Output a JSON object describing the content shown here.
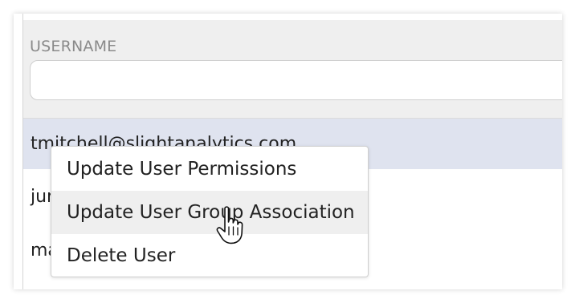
{
  "filter": {
    "label": "USERNAME",
    "value": "",
    "placeholder": ""
  },
  "users": [
    {
      "email": "tmitchell@slightanalytics.com",
      "selected": true
    },
    {
      "email": "jur"
    },
    {
      "email": "ma"
    }
  ],
  "context_menu": {
    "items": [
      {
        "label": "Update User Permissions"
      },
      {
        "label": "Update User Group Association",
        "hovered": true
      },
      {
        "label": "Delete User"
      }
    ]
  },
  "colors": {
    "selected_row": "#dfe3ef",
    "hover_item": "#efefef",
    "filter_background": "#efefef",
    "label_text": "#8a8a8a"
  },
  "cursor": {
    "icon": "hand-pointer-icon"
  }
}
